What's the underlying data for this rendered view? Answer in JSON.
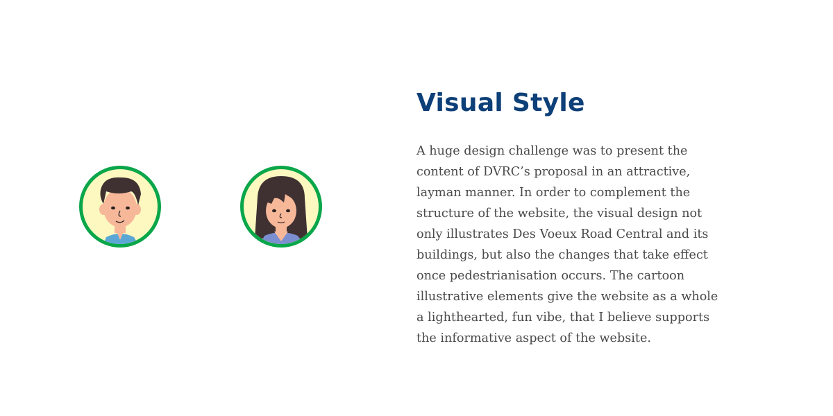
{
  "avatars": [
    {
      "label": "male-character"
    },
    {
      "label": "female-character"
    }
  ],
  "colors": {
    "ring": "#0aa64a",
    "avatar_bg": "#fdf8c0",
    "heading": "#0d3f78",
    "body": "#4a4a4a"
  },
  "section": {
    "title": "Visual Style",
    "lines": [
      "A huge design challenge was to present the",
      "content of DVRC’s proposal in an attractive,",
      "layman manner. In order to complement the",
      "structure of the website, the visual design not",
      "only illustrates Des Voeux Road Central and its",
      "buildings, but also the changes that take effect",
      "once pedestrianisation occurs. The cartoon",
      "illustrative elements give the website as a whole",
      "a lighthearted, fun vibe, that I believe supports",
      "the informative aspect of the website."
    ]
  }
}
